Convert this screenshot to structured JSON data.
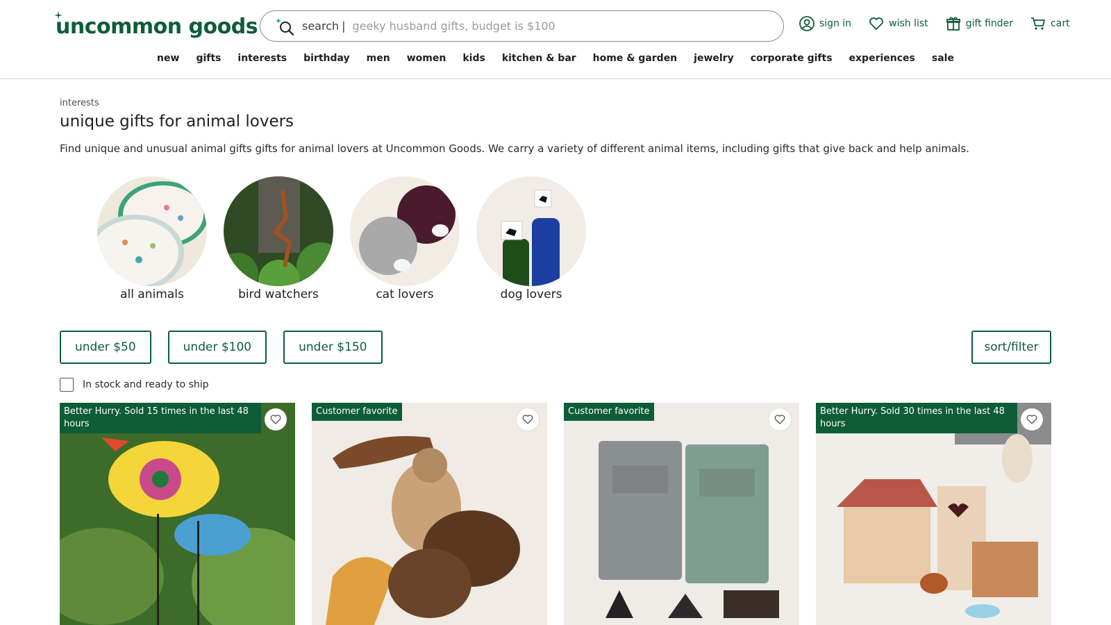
{
  "brand": {
    "logo_text": "uncommon goods",
    "accent": "#0e5c38"
  },
  "search": {
    "label": "search",
    "divider": "|",
    "placeholder": "geeky husband gifts, budget is $100"
  },
  "utilities": [
    {
      "label": "sign in",
      "icon": "user-circle-icon"
    },
    {
      "label": "wish list",
      "icon": "heart-icon"
    },
    {
      "label": "gift finder",
      "icon": "gift-icon"
    },
    {
      "label": "cart",
      "icon": "cart-icon"
    }
  ],
  "nav": [
    "new",
    "gifts",
    "interests",
    "birthday",
    "men",
    "women",
    "kids",
    "kitchen & bar",
    "home & garden",
    "jewelry",
    "corporate gifts",
    "experiences",
    "sale"
  ],
  "page": {
    "breadcrumb": "interests",
    "title": "unique gifts for animal lovers",
    "description": "Find unique and unusual animal gifts gifts for animal lovers at Uncommon Goods. We carry a variety of different animal items, including gifts that give back and help animals."
  },
  "categories": [
    {
      "label": "all animals"
    },
    {
      "label": "bird watchers"
    },
    {
      "label": "cat lovers"
    },
    {
      "label": "dog lovers"
    }
  ],
  "price_filters": [
    "under $50",
    "under $100",
    "under $150"
  ],
  "sort_filter_label": "sort/filter",
  "stock_filter": {
    "label": "In stock and ready to ship",
    "checked": false
  },
  "products": [
    {
      "badge": "Better Hurry. Sold 15 times in the last 48 hours"
    },
    {
      "badge": "Customer favorite"
    },
    {
      "badge": "Customer favorite"
    },
    {
      "badge": "Better Hurry. Sold 30 times in the last 48 hours"
    }
  ]
}
